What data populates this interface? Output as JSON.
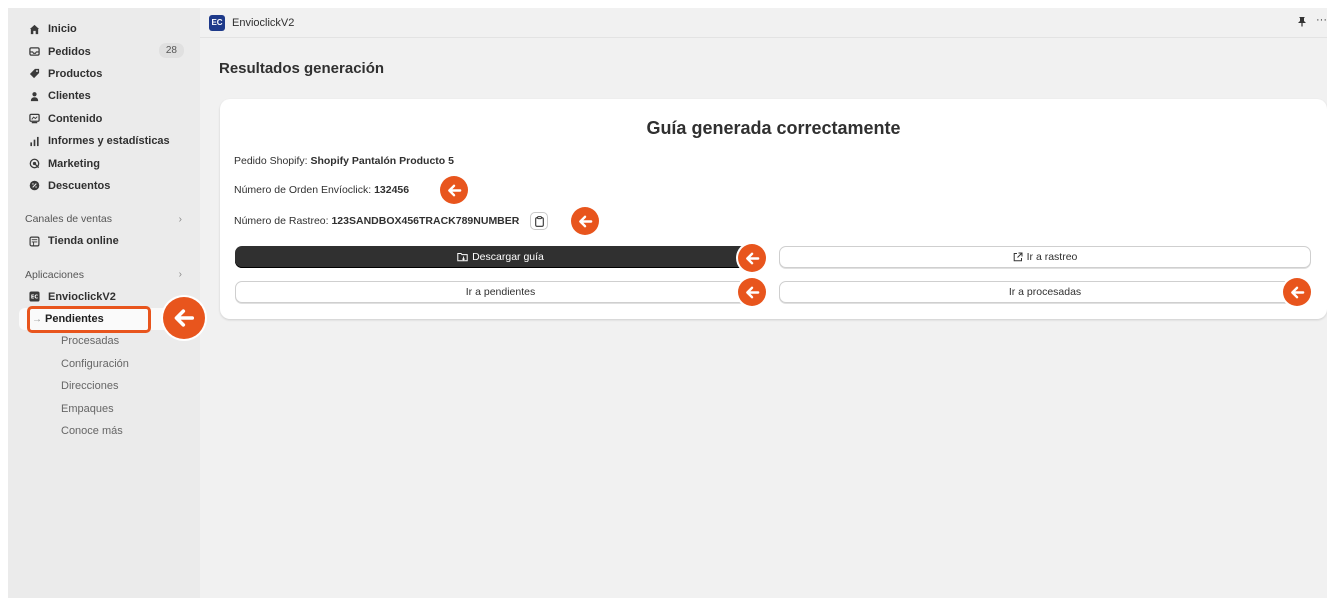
{
  "sidebar": {
    "items": [
      {
        "label": "Inicio",
        "icon": "home-icon"
      },
      {
        "label": "Pedidos",
        "icon": "inbox-icon",
        "badge": "28"
      },
      {
        "label": "Productos",
        "icon": "tag-icon"
      },
      {
        "label": "Clientes",
        "icon": "person-icon"
      },
      {
        "label": "Contenido",
        "icon": "content-icon"
      },
      {
        "label": "Informes y estadísticas",
        "icon": "bar-chart-icon"
      },
      {
        "label": "Marketing",
        "icon": "target-icon"
      },
      {
        "label": "Descuentos",
        "icon": "discount-icon"
      }
    ],
    "sales_channels": {
      "heading": "Canales de ventas",
      "items": [
        {
          "label": "Tienda online",
          "icon": "store-icon"
        }
      ]
    },
    "apps": {
      "heading": "Aplicaciones",
      "app_label": "EnvioclickV2",
      "sub_items": [
        "Pendientes",
        "Procesadas",
        "Configuración",
        "Direcciones",
        "Empaques",
        "Conoce más"
      ],
      "active": "Pendientes"
    }
  },
  "topbar": {
    "app_title": "EnvioclickV2",
    "logo_text": "EC"
  },
  "page": {
    "title": "Resultados generación"
  },
  "card": {
    "heading": "Guía generada correctamente",
    "order_label": "Pedido Shopify: ",
    "order_value": "Shopify Pantalón Producto 5",
    "envioclick_label": "Número de Orden Envíoclick: ",
    "envioclick_value": "132456",
    "tracking_label": "Número de Rastreo: ",
    "tracking_value": "123SANDBOX456TRACK789NUMBER",
    "buttons": {
      "download": "Descargar guía",
      "track": "Ir a rastreo",
      "pending": "Ir a pendientes",
      "processed": "Ir a procesadas"
    }
  },
  "colors": {
    "accent": "#e8551d",
    "primary_button": "#303030",
    "sidebar_bg": "#ebebeb",
    "page_bg": "#f1f1f1"
  }
}
